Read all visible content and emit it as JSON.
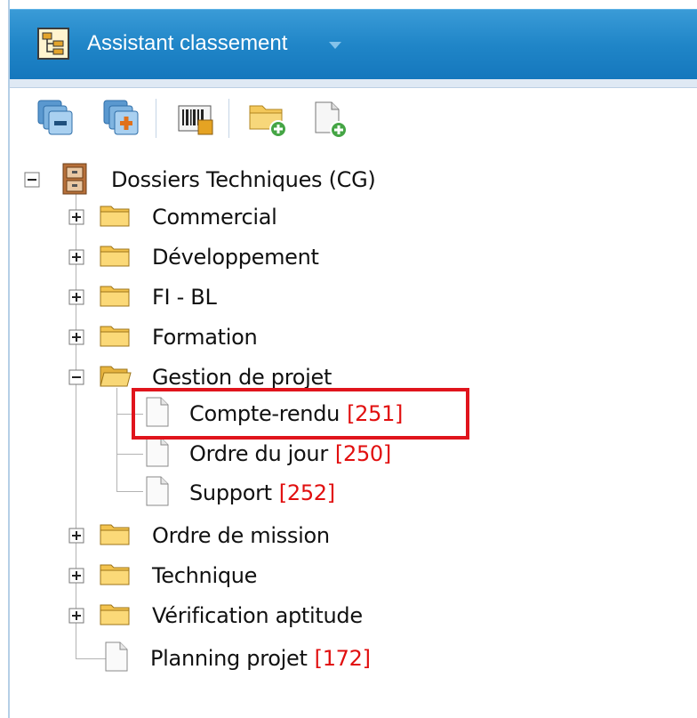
{
  "header": {
    "title": "Assistant classement",
    "dropdown_icon": "caret-down-icon"
  },
  "toolbar": {
    "buttons": [
      {
        "name": "collapse-all-button",
        "icon": "collapse-all-icon"
      },
      {
        "name": "expand-all-button",
        "icon": "expand-all-icon"
      },
      {
        "name": "barcode-button",
        "icon": "barcode-icon"
      },
      {
        "name": "add-folder-button",
        "icon": "folder-add-icon"
      },
      {
        "name": "add-document-button",
        "icon": "document-add-icon"
      }
    ]
  },
  "tree": {
    "root": {
      "label": "Dossiers Techniques (CG)",
      "expanded": true,
      "icon": "cabinet-icon"
    },
    "folders": [
      {
        "label": "Commercial",
        "expanded": false
      },
      {
        "label": "Développement",
        "expanded": false
      },
      {
        "label": "FI - BL",
        "expanded": false
      },
      {
        "label": "Formation",
        "expanded": false
      },
      {
        "label": "Gestion de projet",
        "expanded": true,
        "children": [
          {
            "label": "Compte-rendu",
            "count": "[251]",
            "highlighted": true
          },
          {
            "label": "Ordre du jour",
            "count": "[250]"
          },
          {
            "label": "Support",
            "count": "[252]"
          }
        ]
      },
      {
        "label": "Ordre de mission",
        "expanded": false
      },
      {
        "label": "Technique",
        "expanded": false
      },
      {
        "label": "Vérification aptitude",
        "expanded": false
      }
    ],
    "documents": [
      {
        "label": "Planning projet",
        "count": "[172]"
      }
    ]
  },
  "colors": {
    "titlebar": "#2086c8",
    "count": "#e10f0f",
    "highlight": "#e0141c",
    "folder": "#f7c84a"
  }
}
